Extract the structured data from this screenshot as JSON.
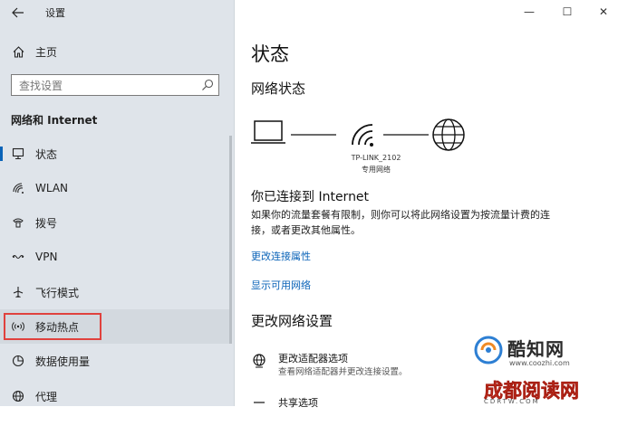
{
  "app": {
    "title": "设置"
  },
  "window_controls": {
    "minimize": "—",
    "maximize": "☐",
    "close": "✕"
  },
  "nav": {
    "home": "主页",
    "search_placeholder": "查找设置",
    "section": "网络和 Internet",
    "items": [
      {
        "label": "状态",
        "icon": "status-icon",
        "active": true
      },
      {
        "label": "WLAN",
        "icon": "wifi-icon"
      },
      {
        "label": "拨号",
        "icon": "dialup-icon"
      },
      {
        "label": "VPN",
        "icon": "vpn-icon"
      },
      {
        "label": "飞行模式",
        "icon": "airplane-icon"
      },
      {
        "label": "移动热点",
        "icon": "hotspot-icon",
        "highlighted": true
      },
      {
        "label": "数据使用量",
        "icon": "data-usage-icon"
      },
      {
        "label": "代理",
        "icon": "globe-icon"
      }
    ]
  },
  "main": {
    "title": "状态",
    "network_status": "网络状态",
    "network": {
      "name": "TP-LINK_2102",
      "type": "专用网络"
    },
    "connected_title": "你已连接到 Internet",
    "connected_desc": "如果你的流量套餐有限制，则你可以将此网络设置为按流量计费的连接，或者更改其他属性。",
    "link_change_props": "更改连接属性",
    "link_show_networks": "显示可用网络",
    "change_settings": "更改网络设置",
    "options": [
      {
        "title": "更改适配器选项",
        "desc": "查看网络适配器并更改连接设置。"
      },
      {
        "title": "共享选项",
        "desc": ""
      }
    ]
  },
  "watermark": {
    "name": "酷知网",
    "url": "www.coozhi.com",
    "name2": "成都阅读网",
    "url2": "CDRTW.COM"
  },
  "colors": {
    "accent": "#0a63b8",
    "highlight_box": "#e0413d",
    "nav_bg": "#dfe4ea"
  }
}
